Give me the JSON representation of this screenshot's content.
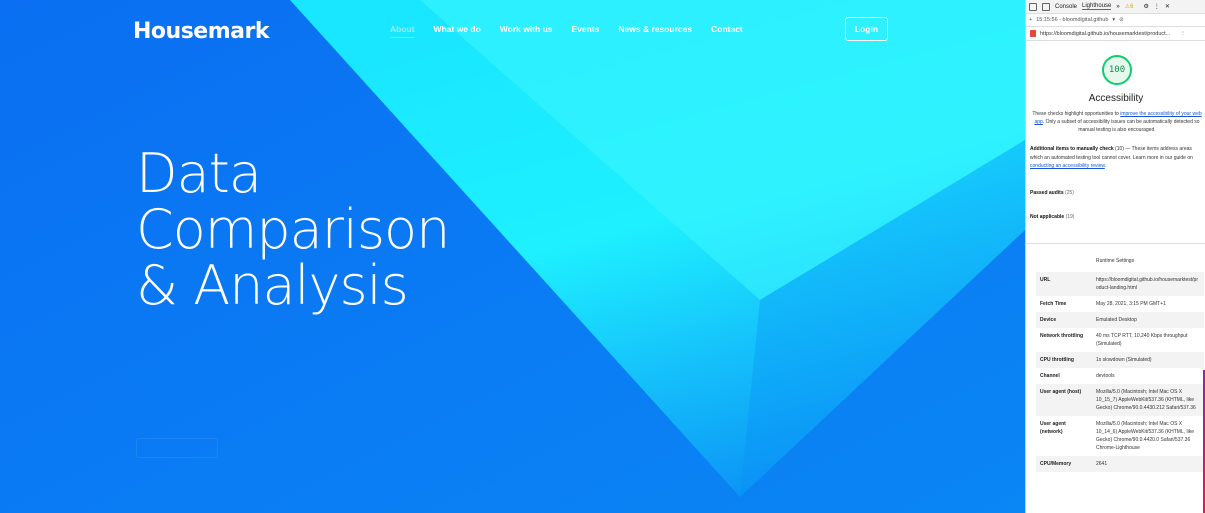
{
  "site": {
    "brand": "Housemark",
    "nav": [
      "About",
      "What we do",
      "Work with us",
      "Events",
      "News & resources",
      "Contact"
    ],
    "login": "Login",
    "hero": [
      "Data",
      "Comparison",
      "& Analysis"
    ],
    "colors": {
      "background": "#0a6ff2",
      "beam": "#1ef0ff",
      "active_nav": "#8ff0ff"
    }
  },
  "devtools": {
    "tabs": [
      "Console",
      "Lighthouse",
      "»"
    ],
    "warning_count": "6",
    "report_time": "15:15:56 - bloomdigital.github",
    "url": "https://bloomdigital.github.io/housemarktest/product...",
    "score": "100",
    "category": "Accessibility",
    "description_pre": "These checks highlight opportunities to ",
    "description_link": "improve the accessibility of your web app",
    "description_post": ". Only a subset of accessibility issues can be automatically detected so manual testing is also encouraged.",
    "manual_title": "Additional items to manually check",
    "manual_count": "(10)",
    "manual_text": " — These items address areas which an automated testing tool cannot cover. Learn more in our guide on ",
    "manual_link": "conducting an accessibility review",
    "passed_label": "Passed audits",
    "passed_count": "(25)",
    "notapp_label": "Not applicable",
    "notapp_count": "(19)",
    "runtime_title": "Runtime Settings",
    "runtime": [
      {
        "key": "URL",
        "value": "https://bloomdigital.github.io/housemarktest/product-landing.html"
      },
      {
        "key": "Fetch Time",
        "value": "May 28, 2021, 3:15 PM GMT+1"
      },
      {
        "key": "Device",
        "value": "Emulated Desktop"
      },
      {
        "key": "Network throttling",
        "value": "40 ms TCP RTT, 10,240 Kbps throughput (Simulated)"
      },
      {
        "key": "CPU throttling",
        "value": "1x slowdown (Simulated)"
      },
      {
        "key": "Channel",
        "value": "devtools"
      },
      {
        "key": "User agent (host)",
        "value": "Mozilla/5.0 (Macintosh; Intel Mac OS X 10_15_7) AppleWebKit/537.36 (KHTML, like Gecko) Chrome/90.0.4430.212 Safari/537.36"
      },
      {
        "key": "User agent (network)",
        "value": "Mozilla/5.0 (Macintosh; Intel Mac OS X 10_14_6) AppleWebKit/537.36 (KHTML, like Gecko) Chrome/90.0.4420.0 Safari/537.36 Chrome-Lighthouse"
      },
      {
        "key": "CPU/Memory",
        "value": "2641"
      }
    ]
  }
}
